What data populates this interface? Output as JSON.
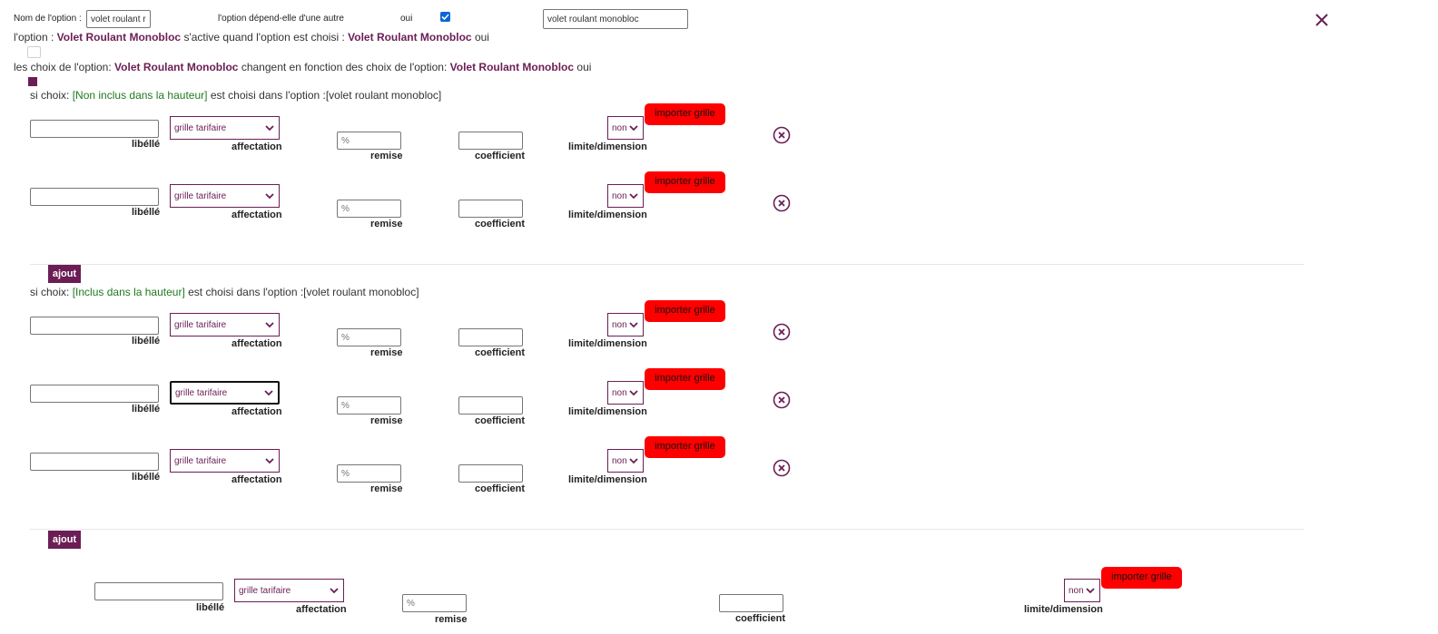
{
  "header": {
    "nom_label": "Nom de l'option :",
    "nom_value": "volet roulant r",
    "depend_label": "l'option dépend-elle d'une autre",
    "depend_oui": "oui",
    "depend_value": "volet roulant monobloc"
  },
  "line1": {
    "prefix": "l'option :",
    "option_name": "Volet Roulant Monobloc",
    "mid": "s'active quand l'option est choisi :",
    "choice_name": "Volet Roulant Monobloc",
    "suffix": "oui"
  },
  "line2": {
    "prefix": "les choix de l'option:",
    "option_name": "Volet Roulant Monobloc",
    "mid": "changent en fonction des choix de l'option:",
    "choice_name": "Volet Roulant Monobloc",
    "suffix": "oui"
  },
  "sections": [
    {
      "prefix": "si choix:",
      "choice": "[Non inclus dans la hauteur]",
      "suffix": "est choisi dans l'option :[volet roulant monobloc]"
    },
    {
      "prefix": "si choix:",
      "choice": "[Inclus dans la hauteur]",
      "suffix": "est choisi dans l'option :[volet roulant monobloc]"
    }
  ],
  "row": {
    "libelle_label": "libéllé",
    "affectation_label": "affectation",
    "affectation_value": "grille tarifaire",
    "remise_label": "remise",
    "remise_placeholder": "%",
    "coefficient_label": "coefficient",
    "limite_label": "limite/dimension",
    "limite_value": "non",
    "importer_label": "importer grille"
  },
  "ajout_label": "ajout",
  "colors": {
    "accent": "#6b1e55",
    "import": "#ff0000",
    "choice_green": "#1f7a1f"
  },
  "icons": {
    "close": "close-icon",
    "remove": "circle-x-icon",
    "chevron": "chevron-down-icon"
  }
}
